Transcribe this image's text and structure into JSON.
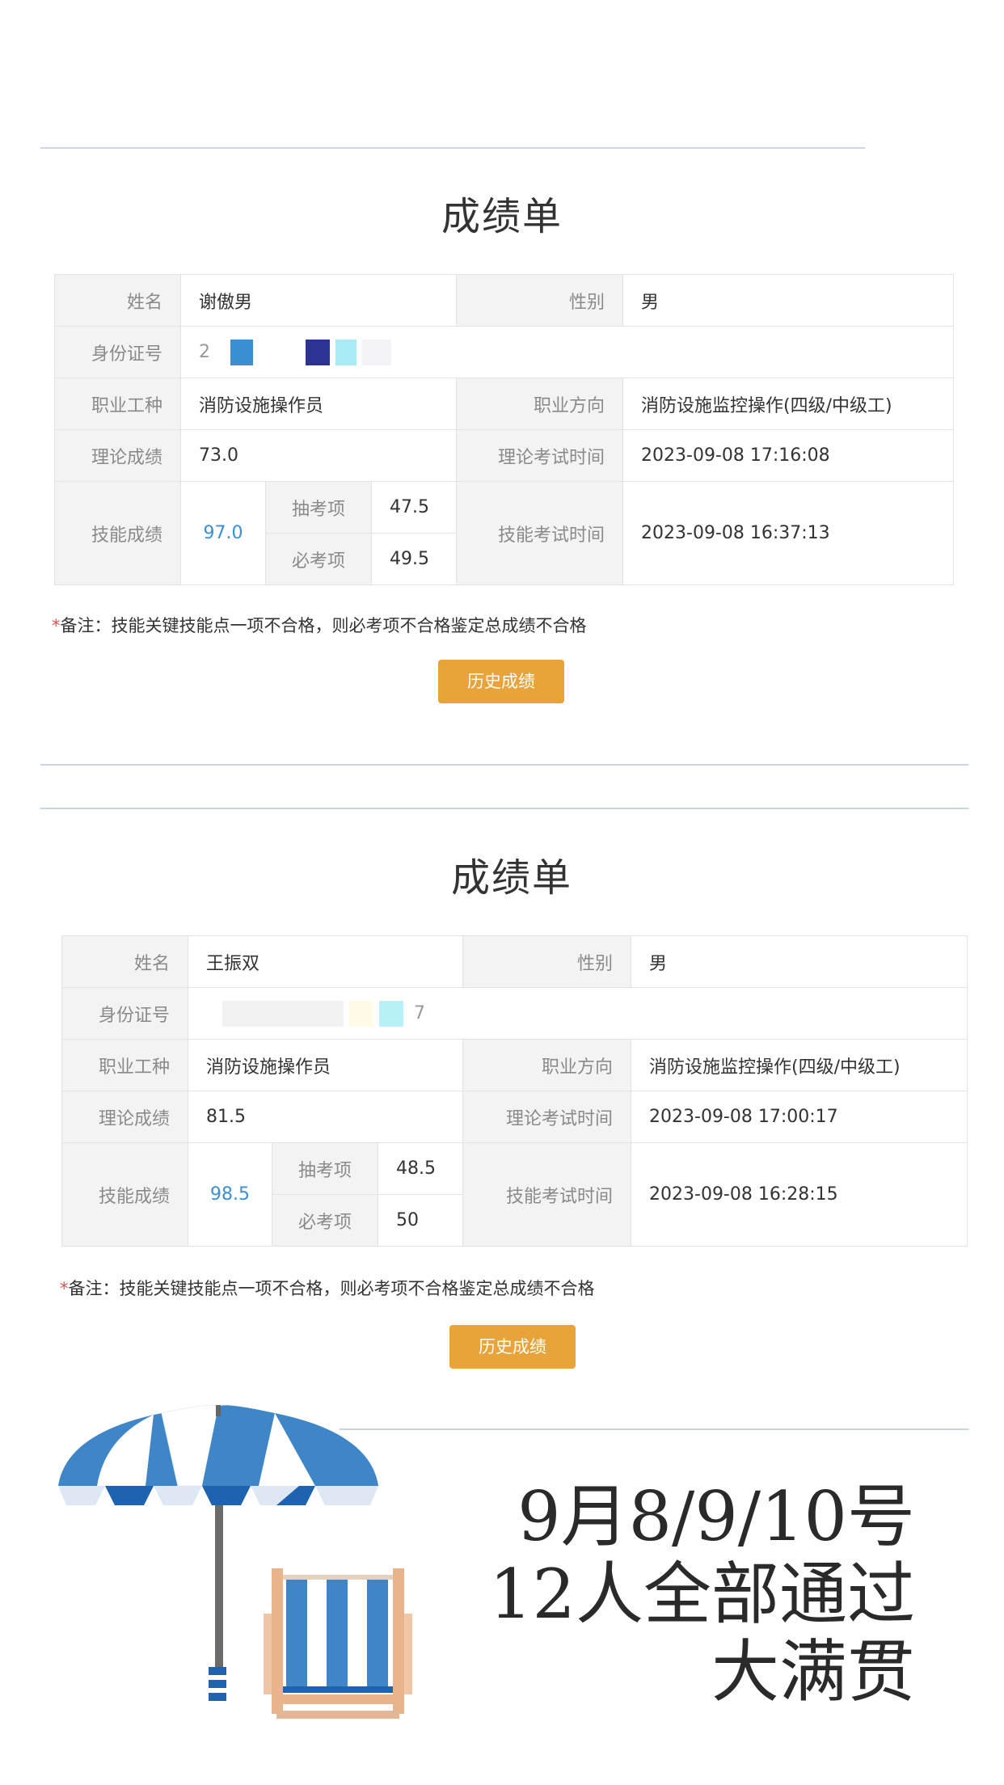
{
  "cards": [
    {
      "title": "成绩单",
      "labels": {
        "name": "姓名",
        "gender": "性别",
        "id_number": "身份证号",
        "occupation": "职业工种",
        "direction": "职业方向",
        "theory_score": "理论成绩",
        "theory_time": "理论考试时间",
        "skill_score": "技能成绩",
        "skill_time": "技能考试时间",
        "random_item": "抽考项",
        "required_item": "必考项"
      },
      "name": "谢傲男",
      "gender": "男",
      "id_number_visible": "2",
      "occupation": "消防设施操作员",
      "direction": "消防设施监控操作(四级/中级工)",
      "theory_score": "73.0",
      "theory_time": "2023-09-08 17:16:08",
      "skill_score": "97.0",
      "random_item_score": "47.5",
      "required_item_score": "49.5",
      "skill_time": "2023-09-08 16:37:13",
      "note_star": "*",
      "note": "备注：技能关键技能点一项不合格，则必考项不合格鉴定总成绩不合格",
      "button": "历史成绩"
    },
    {
      "title": "成绩单",
      "labels": {
        "name": "姓名",
        "gender": "性别",
        "id_number": "身份证号",
        "occupation": "职业工种",
        "direction": "职业方向",
        "theory_score": "理论成绩",
        "theory_time": "理论考试时间",
        "skill_score": "技能成绩",
        "skill_time": "技能考试时间",
        "random_item": "抽考项",
        "required_item": "必考项"
      },
      "name": "王振双",
      "gender": "男",
      "id_number_visible": "7",
      "occupation": "消防设施操作员",
      "direction": "消防设施监控操作(四级/中级工)",
      "theory_score": "81.5",
      "theory_time": "2023-09-08 17:00:17",
      "skill_score": "98.5",
      "random_item_score": "48.5",
      "required_item_score": "50",
      "skill_time": "2023-09-08 16:28:15",
      "note_star": "*",
      "note": "备注：技能关键技能点一项不合格，则必考项不合格鉴定总成绩不合格",
      "button": "历史成绩"
    }
  ],
  "slogan": {
    "line1": "9月8/9/10号",
    "line2": "12人全部通过",
    "line3": "大满贯"
  },
  "colors": {
    "accent_button": "#e8a33b",
    "skill_score_blue": "#3b8fd6",
    "note_star_red": "#d9534f",
    "umbrella_blue": "#3f86c8"
  },
  "icons": [
    "beach-umbrella-icon",
    "beach-chair-icon"
  ]
}
